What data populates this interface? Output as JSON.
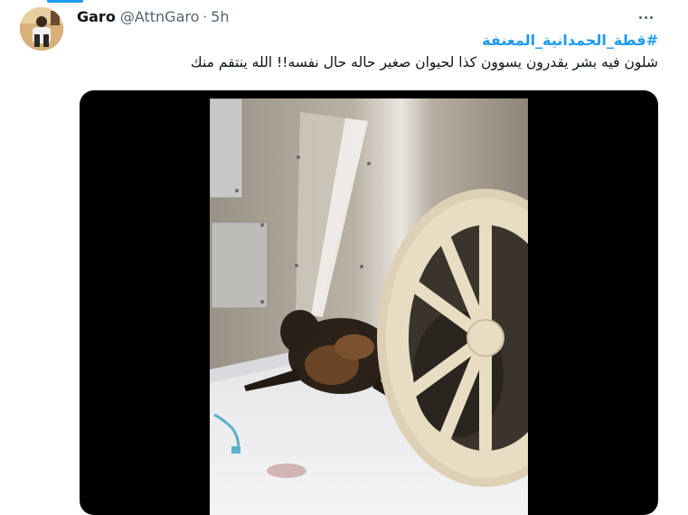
{
  "tweet": {
    "display_name": "Garo",
    "handle": "@AttnGaro",
    "separator": "·",
    "time": "5h",
    "hashtag": "#قطة_الحمدانية_المعنفة",
    "text": "شلون فيه بشر يقدرون يسوون كذا لحيوان صغير حاله حال نفسه!! الله ينتقم منك"
  },
  "icons": {
    "more": "more-horizontal-icon"
  },
  "colors": {
    "accent": "#1d9bf0",
    "secondary_text": "#536471",
    "primary_text": "#0f1419",
    "media_background": "#000000"
  }
}
